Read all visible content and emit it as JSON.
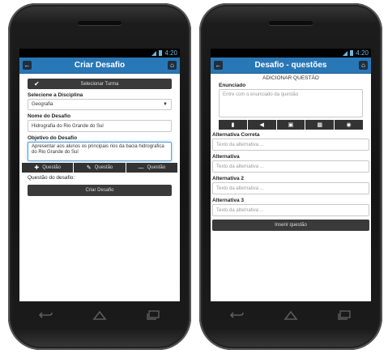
{
  "left": {
    "status_time": "4:20",
    "title": "Criar Desafio",
    "select_turma": "Selecionar Turma",
    "disciplina_label": "Selecione a Disciplina",
    "disciplina_value": "Geografia",
    "nome_label": "Nome do Desafio",
    "nome_value": "Hidrografia do Rio Grande do Sul",
    "objetivo_label": "Objetivo do Desafio",
    "objetivo_value": "Apresentar aos alunos os principais rios da bacia hidrografica do Rio Grande do Sul",
    "toolbar": [
      "Questão",
      "Questão",
      "Questão"
    ],
    "questao_label": "Questão do desafio:",
    "criar_button": "Criar Desafio"
  },
  "right": {
    "status_time": "4:20",
    "title": "Desafio - questões",
    "section_title": "ADICIONAR QUESTÃO",
    "enunciado_label": "Enunciado",
    "enunciado_placeholder": "Entre com o enunciado da questão",
    "alt_correta_label": "Alternativa Correta",
    "alt_label": "Alternativa",
    "alt2_label": "Alternativa 2",
    "alt3_label": "Alternativa 3",
    "alt_placeholder": "Texto da alternativa ...",
    "inserir_button": "Inserir questão"
  },
  "colors": {
    "appbar": "#2878b8",
    "status_icon": "#6fb7dd",
    "button": "#3a3a3a"
  },
  "icons": [
    "back-arrow-icon",
    "home-icon",
    "check-icon",
    "plus-icon",
    "pencil-icon",
    "minus-icon",
    "video-icon",
    "audio-icon",
    "image-icon",
    "document-icon",
    "settings-icon",
    "nav-back-icon",
    "nav-home-icon",
    "nav-recent-icon",
    "signal-icon",
    "battery-icon"
  ]
}
